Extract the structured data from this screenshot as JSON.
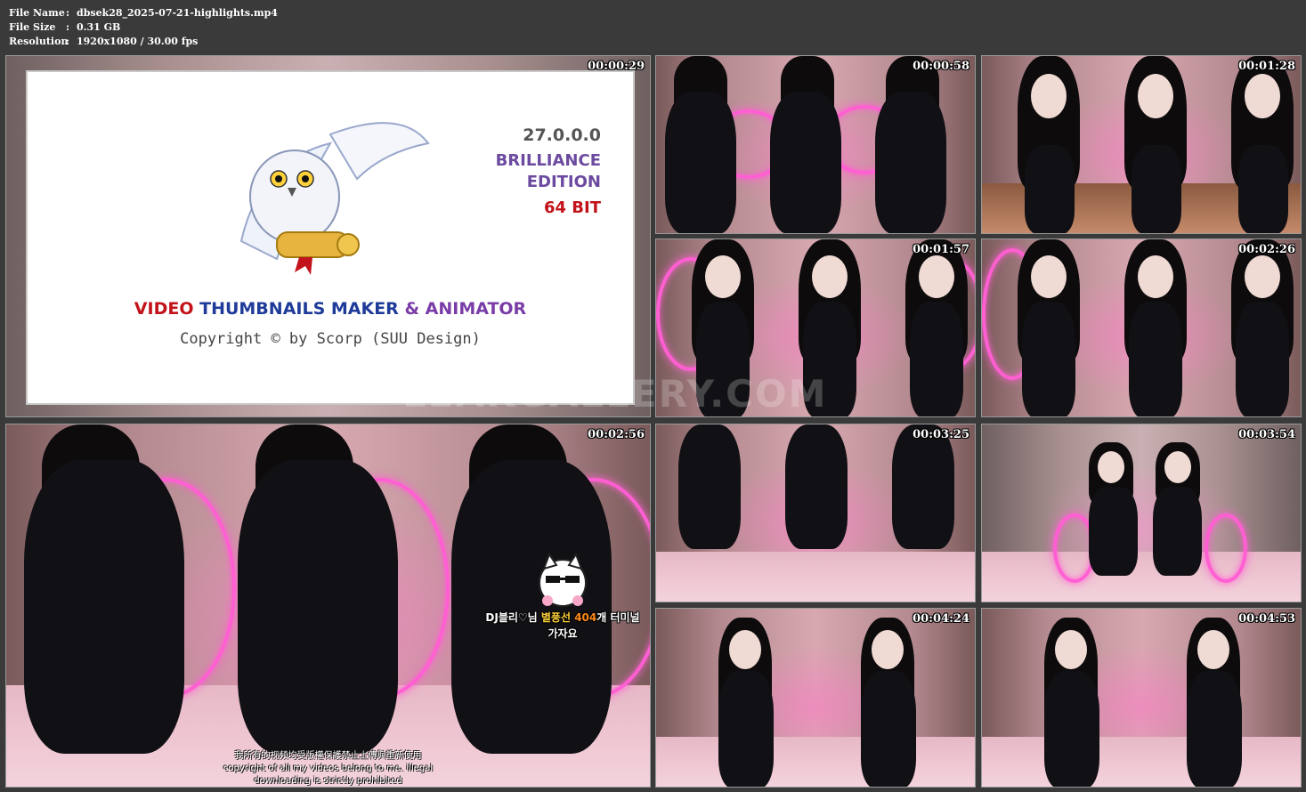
{
  "header": {
    "file_name_label": "File Name",
    "file_name_value": "dbsek28_2025-07-21-highlights.mp4",
    "file_size_label": "File Size",
    "file_size_value": "0.31 GB",
    "resolution_label": "Resolution",
    "resolution_value": "1920x1080 / 30.00 fps",
    "separator": ":"
  },
  "splash": {
    "version": "27.0.0.0",
    "edition_line1": "BRILLIANCE",
    "edition_line2": "EDITION",
    "bits": "64 BIT",
    "product_part1": "VIDEO",
    "product_part2": "THUMBNAILS MAKER",
    "product_part3": "& ANIMATOR",
    "copyright": "Copyright © by Scorp (SUU Design)"
  },
  "watermark": "LEAKGALLERY.COM",
  "thumbnails": [
    {
      "timestamp": "00:00:29"
    },
    {
      "timestamp": "00:00:58"
    },
    {
      "timestamp": "00:01:28"
    },
    {
      "timestamp": "00:01:57"
    },
    {
      "timestamp": "00:02:26"
    },
    {
      "timestamp": "00:02:56"
    },
    {
      "timestamp": "00:03:25"
    },
    {
      "timestamp": "00:03:54"
    },
    {
      "timestamp": "00:04:24"
    },
    {
      "timestamp": "00:04:53"
    }
  ],
  "large_tile": {
    "chat_line1_part1": "DJ블리♡님 ",
    "chat_line1_part2": "별풍선 ",
    "chat_line1_part3": "404",
    "chat_line1_part4": "개 터미널",
    "chat_line2": "가자요",
    "subtitle_line1": "我所有的视频均受版權保護禁止上傳與重新使用",
    "subtitle_line2": "copyright of all my videos belong to me. illegal",
    "subtitle_line3": "downloading is strictly prohibited"
  },
  "colors": {
    "background": "#3a3a3a",
    "neon_pink": "#ff5fd2",
    "version_red": "#c2121a",
    "edition_purple": "#6b4aa0",
    "brand_blue": "#1f3b9a"
  }
}
